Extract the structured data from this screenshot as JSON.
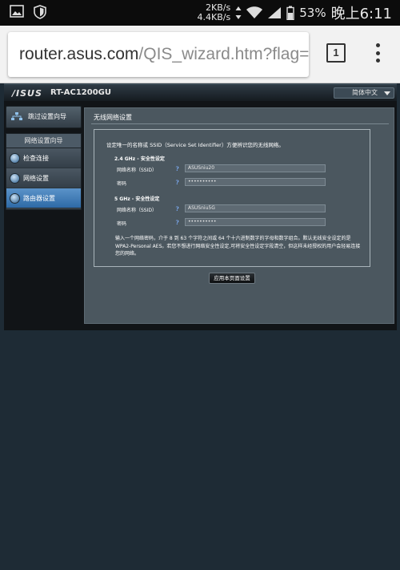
{
  "status_bar": {
    "net_upload": "2KB/s",
    "net_download": "4.4KB/s",
    "battery_percent": "53%",
    "time": "晚上6:11"
  },
  "browser": {
    "url_host": "router.asus.com",
    "url_path": "/QIS_wizard.htm?flag=w",
    "tab_count": "1"
  },
  "router": {
    "brand": "/ISUS",
    "model": "RT-AC1200GU",
    "language": "简体中文"
  },
  "sidebar": {
    "skip_label": "跳过设置向导",
    "nav_header": "网络设置向导",
    "items": [
      {
        "label": "检查连接"
      },
      {
        "label": "网络设置"
      },
      {
        "label": "路由器设置"
      }
    ]
  },
  "main": {
    "title": "无线网络设置",
    "intro": "设定唯一的名称或 SSID（Service Set Identifier）方便辨识您的无线网络。",
    "band_24": {
      "section_label": "2.4 GHz - 安全性设定",
      "ssid_label": "网络名称（SSID）",
      "ssid_value": "ASUSniu20",
      "password_label": "密码",
      "password_value": "••••••••••"
    },
    "band_5": {
      "section_label": "5 GHz - 安全性设定",
      "ssid_label": "网络名称（SSID）",
      "ssid_value": "ASUSniu5G",
      "password_label": "密码",
      "password_value": "••••••••••"
    },
    "note": "输入一个网络密码，介于 8 到 63 个字符之间或 64 个十六进制数字的字母和数字组合。默认无线安全设定的是 WPA2-Personal AES。若您不想进行网络安全性设定,可将安全性设定字段清空，但这样未经授权的用户会轻易连接您的网络。",
    "help_glyph": "?",
    "apply_label": "应用本页面设置"
  }
}
